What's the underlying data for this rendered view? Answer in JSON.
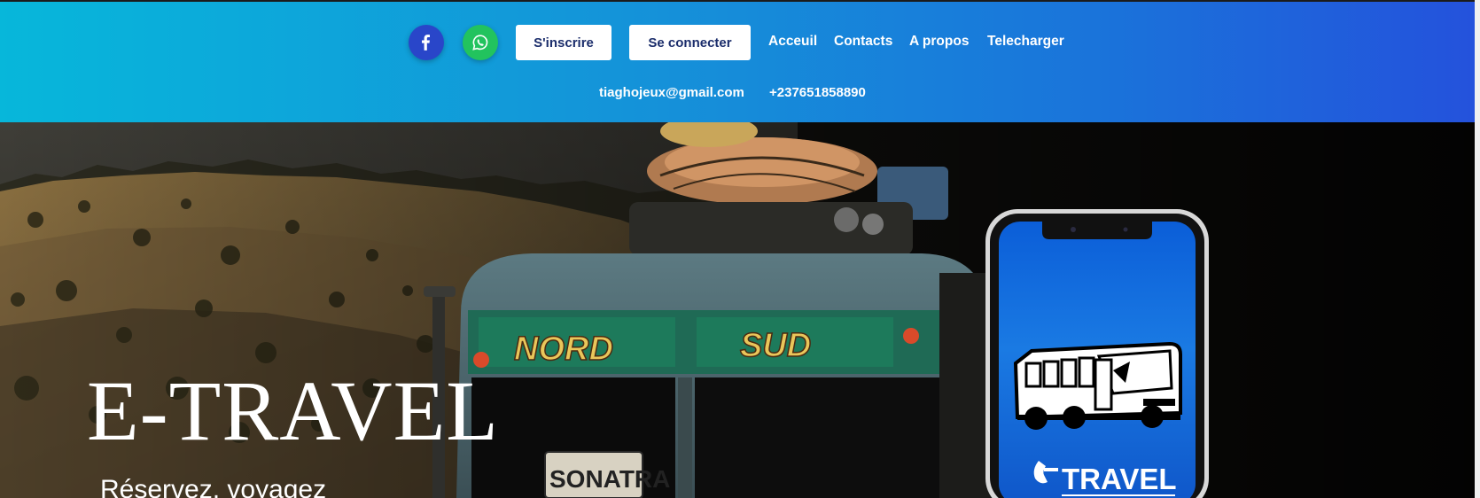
{
  "header": {
    "social": [
      {
        "name": "facebook",
        "icon": "facebook-icon",
        "color": "#2946c9"
      },
      {
        "name": "whatsapp",
        "icon": "whatsapp-icon",
        "color": "#22c35e"
      }
    ],
    "signup_label": "S'inscrire",
    "login_label": "Se connecter",
    "nav": [
      "Acceuil",
      "Contacts",
      "A propos",
      "Telecharger"
    ],
    "email": "tiaghojeux@gmail.com",
    "phone": "+237651858890",
    "gradient_start": "#07b7da",
    "gradient_end": "#2452dc"
  },
  "hero": {
    "title": "E-TRAVEL",
    "subtitle": "Réservez, voyagez",
    "bus_sign_left": "NORD",
    "bus_sign_right": "SUD",
    "bus_plate": "SONATRA",
    "app_logo_text": "TRAVEL"
  }
}
